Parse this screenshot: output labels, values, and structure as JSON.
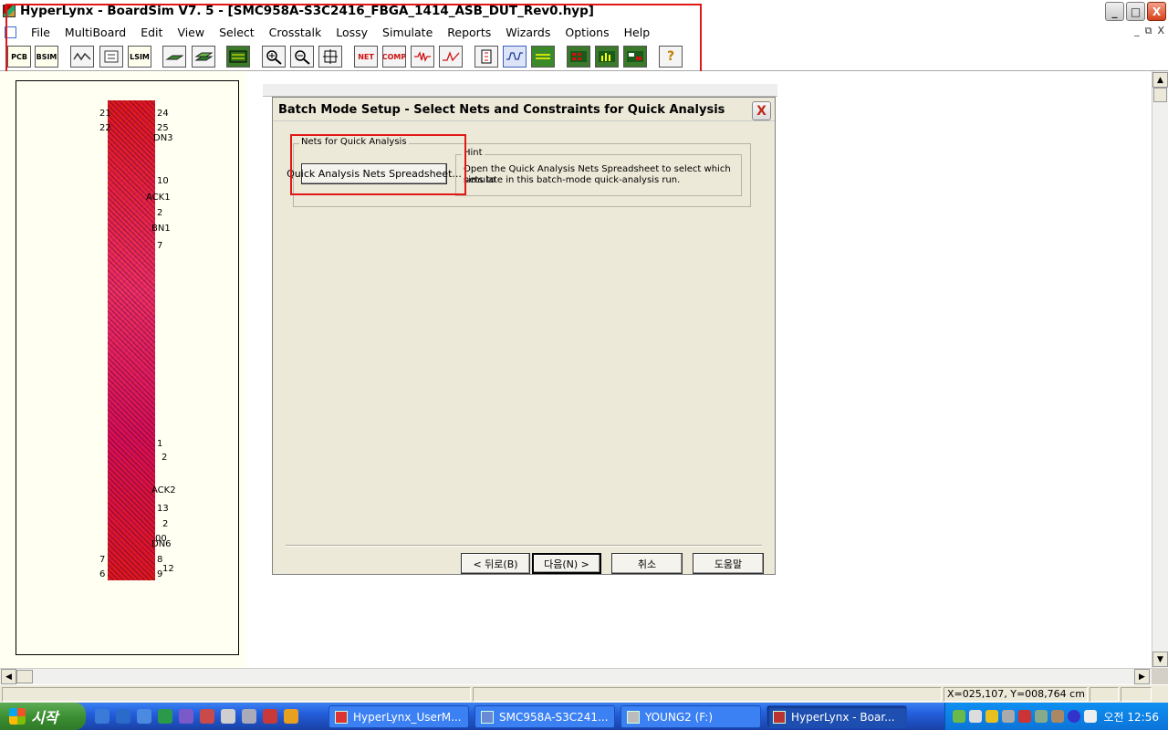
{
  "window": {
    "title": "HyperLynx - BoardSim V7. 5 - [SMC958A-S3C2416_FBGA_1414_ASB_DUT_Rev0.hyp]",
    "controls": [
      "_",
      "□",
      "X"
    ],
    "mdi_controls": [
      "_",
      "⧉",
      "X"
    ]
  },
  "menu": [
    "File",
    "MultiBoard",
    "Edit",
    "View",
    "Select",
    "Crosstalk",
    "Lossy",
    "Simulate",
    "Reports",
    "Wizards",
    "Options",
    "Help"
  ],
  "toolbar": {
    "buttons": [
      {
        "label": "PCB",
        "icon": "pcb-icon"
      },
      {
        "label": "BSIM",
        "icon": "bsim-icon"
      },
      {
        "label": "",
        "icon": "waveform-icon"
      },
      {
        "label": "",
        "icon": "schematic-icon"
      },
      {
        "label": "LSIM",
        "icon": "lsim-icon"
      },
      {
        "label": "",
        "icon": "layer-icon"
      },
      {
        "label": "",
        "icon": "stackup-icon"
      },
      {
        "label": "",
        "icon": "board-view-icon"
      },
      {
        "label": "",
        "icon": "zoom-in-icon"
      },
      {
        "label": "",
        "icon": "zoom-out-icon"
      },
      {
        "label": "",
        "icon": "fit-icon"
      },
      {
        "label": "NET",
        "icon": "net-icon"
      },
      {
        "label": "COMP",
        "icon": "comp-icon"
      },
      {
        "label": "",
        "icon": "terminator-icon"
      },
      {
        "label": "",
        "icon": "signal-icon"
      },
      {
        "label": "",
        "icon": "ibis-icon"
      },
      {
        "label": "",
        "icon": "oscilloscope-icon"
      },
      {
        "label": "",
        "icon": "crosstalk-icon"
      },
      {
        "label": "",
        "icon": "batch-icon"
      },
      {
        "label": "",
        "icon": "report-chart-icon"
      },
      {
        "label": "",
        "icon": "spreadsheet-icon"
      },
      {
        "label": "?",
        "icon": "help-icon"
      }
    ]
  },
  "board": {
    "pin_labels": [
      "21",
      "24",
      "22",
      "25",
      "DN3",
      "10",
      "ACK1",
      "2",
      "BN1",
      "7",
      "1",
      "2",
      "ACK2",
      "13",
      "2",
      "00",
      "DN6",
      "7",
      "8",
      "6",
      "12",
      "9"
    ]
  },
  "dialog": {
    "title": "Batch Mode Setup - Select Nets and Constraints for Quick Analysis",
    "close": "X",
    "group_nets_label": "Nets for Quick Analysis",
    "spreadsheet_button": "Quick Analysis Nets Spreadsheet...",
    "hint_label": "Hint",
    "hint_text_line1": "Open the Quick Analysis Nets Spreadsheet to select which nets to",
    "hint_text_line2": "simulate in this batch-mode quick-analysis run.",
    "buttons": {
      "back": "< 뒤로(B)",
      "next": "다음(N) >",
      "cancel": "취소",
      "help": "도움말"
    }
  },
  "statusbar": {
    "coords": "X=025,107, Y=008,764 cm"
  },
  "taskbar": {
    "start": "시작",
    "tasks": [
      {
        "label": "HyperLynx_UserM...",
        "icon": "pdf-icon"
      },
      {
        "label": "SMC958A-S3C241...",
        "icon": "pcb-app-icon"
      },
      {
        "label": "YOUNG2 (F:)",
        "icon": "drive-icon"
      },
      {
        "label": "HyperLynx - Boar...",
        "icon": "hyperlynx-icon",
        "active": true
      }
    ],
    "clock": "오전 12:56"
  },
  "colors": {
    "highlight_red": "#e01818",
    "board_red": "#e01818",
    "taskbar_blue": "#245edb",
    "start_green": "#3c8f32"
  }
}
